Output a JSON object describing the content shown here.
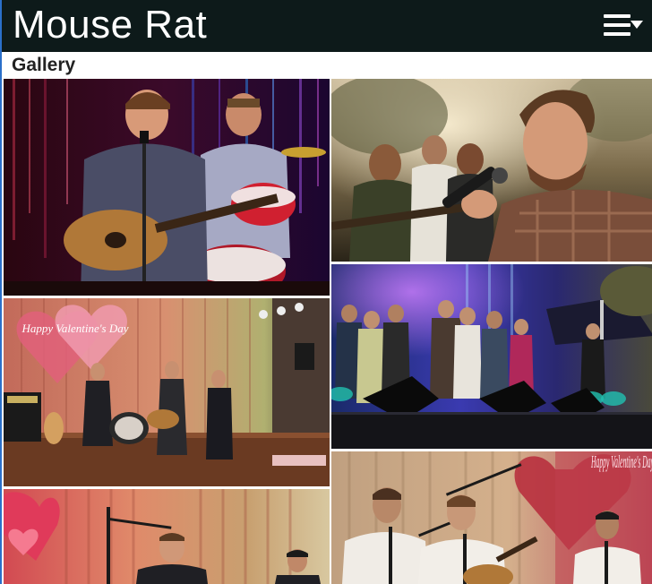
{
  "header": {
    "title": "Mouse Rat",
    "menu_icon": "hamburger-menu-dropdown-icon"
  },
  "page": {
    "section_title": "Gallery"
  },
  "colors": {
    "header_bg": "#0d1a1a",
    "accent_border": "#2a6fc9",
    "header_text": "#ffffff"
  },
  "gallery": {
    "photos": [
      {
        "id": "photo-1",
        "subject": "singer-with-acoustic-guitar-and-drummer"
      },
      {
        "id": "photo-2",
        "subject": "singer-at-microphone-outdoors"
      },
      {
        "id": "photo-3",
        "subject": "band-on-stage-valentines-banner"
      },
      {
        "id": "photo-4",
        "subject": "band-on-large-outdoor-stage"
      },
      {
        "id": "photo-5",
        "subject": "band-close-up-pink-curtain"
      },
      {
        "id": "photo-6",
        "subject": "band-close-up-valentines-banner"
      }
    ],
    "banner_text_1": "Happy Valentine's Day",
    "banner_text_2": "Happy Valentine's Day"
  }
}
